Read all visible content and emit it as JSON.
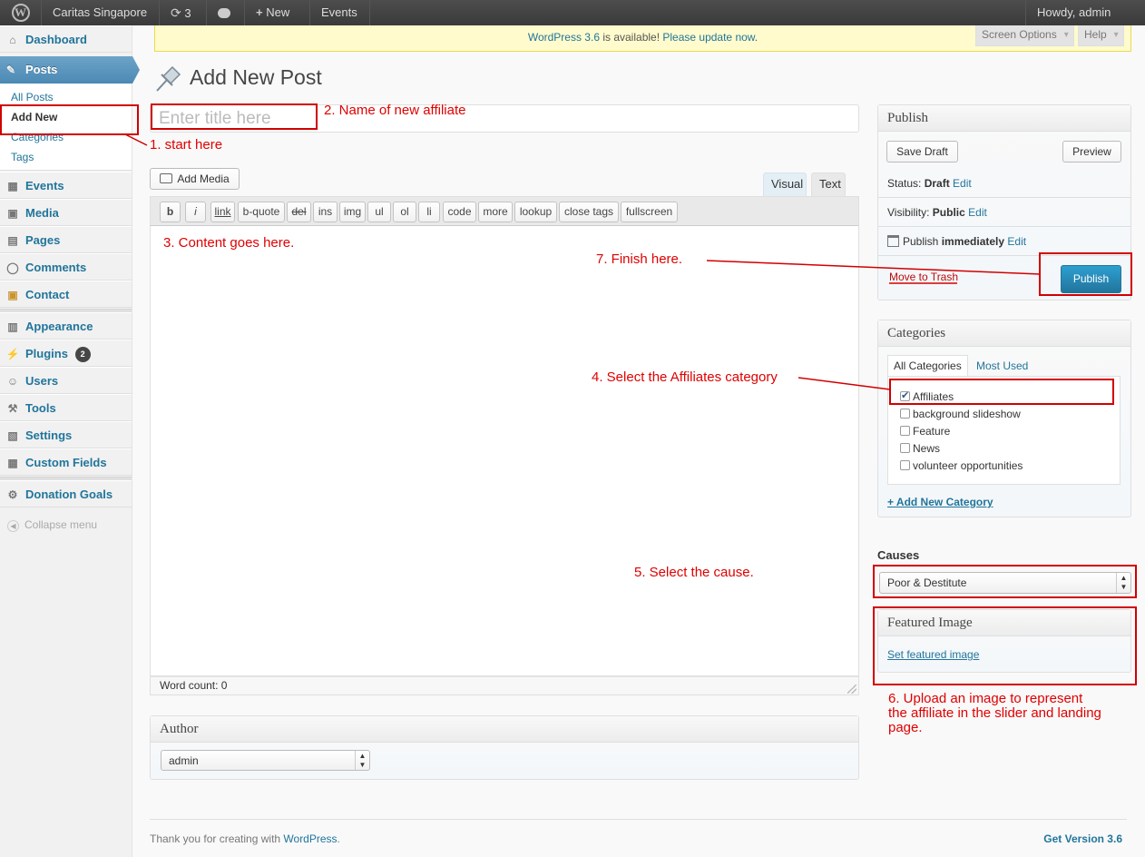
{
  "adminbar": {
    "site_name": "Caritas Singapore",
    "updates_count": "3",
    "new_label": "New",
    "events_label": "Events",
    "howdy": "Howdy, admin"
  },
  "sidebar": {
    "dashboard": "Dashboard",
    "posts": "Posts",
    "sub_all_posts": "All Posts",
    "sub_add_new": "Add New",
    "sub_categories": "Categories",
    "sub_tags": "Tags",
    "events": "Events",
    "media": "Media",
    "pages": "Pages",
    "comments": "Comments",
    "contact": "Contact",
    "appearance": "Appearance",
    "plugins": "Plugins",
    "plugins_badge": "2",
    "users": "Users",
    "tools": "Tools",
    "settings": "Settings",
    "custom_fields": "Custom Fields",
    "donation_goals": "Donation Goals",
    "collapse": "Collapse menu"
  },
  "nag": {
    "version_link": "WordPress 3.6",
    "middle": " is available! ",
    "update_link": "Please update now",
    "end": "."
  },
  "screen_options": "Screen Options",
  "help": "Help",
  "page": {
    "title": "Add New Post",
    "title_placeholder": "Enter title here"
  },
  "editor": {
    "add_media": "Add Media",
    "tab_visual": "Visual",
    "tab_text": "Text",
    "buttons": [
      "b",
      "i",
      "link",
      "b-quote",
      "del",
      "ins",
      "img",
      "ul",
      "ol",
      "li",
      "code",
      "more",
      "lookup",
      "close tags",
      "fullscreen"
    ],
    "word_count": "Word count: 0"
  },
  "publish": {
    "title": "Publish",
    "save_draft": "Save Draft",
    "preview": "Preview",
    "status_label": "Status: ",
    "status_value": "Draft",
    "visibility_label": "Visibility: ",
    "visibility_value": "Public",
    "publish_label": "Publish ",
    "publish_value": "immediately",
    "edit": "Edit",
    "move_to_trash": "Move to Trash",
    "publish_button": "Publish"
  },
  "categories": {
    "title": "Categories",
    "tab_all": "All Categories",
    "tab_most_used": "Most Used",
    "items": [
      {
        "label": "Affiliates",
        "checked": true
      },
      {
        "label": "background slideshow",
        "checked": false
      },
      {
        "label": "Feature",
        "checked": false
      },
      {
        "label": "News",
        "checked": false
      },
      {
        "label": "volunteer opportunities",
        "checked": false
      }
    ],
    "add_new": "+ Add New Category"
  },
  "causes": {
    "label": "Causes",
    "selected": "Poor & Destitute"
  },
  "featured_image": {
    "title": "Featured Image",
    "link": "Set featured image"
  },
  "author": {
    "title": "Author",
    "selected": "admin"
  },
  "footer": {
    "thanks": "Thank you for creating with ",
    "wp_link": "WordPress",
    "dot": ".",
    "version": "Get Version 3.6"
  },
  "annotations": {
    "a1": "1. start here",
    "a2": "2. Name of new affiliate",
    "a3": "3. Content goes here.",
    "a4": "4. Select the Affiliates category",
    "a5": "5. Select the cause.",
    "a6_l1": "6. Upload an image to represent",
    "a6_l2": "the affiliate in the slider and landing",
    "a6_l3": "page.",
    "a7": "7. Finish here."
  },
  "colors": {
    "accent": "#21759b",
    "annotation": "#e00000",
    "publish_button": "#2a95c5"
  }
}
